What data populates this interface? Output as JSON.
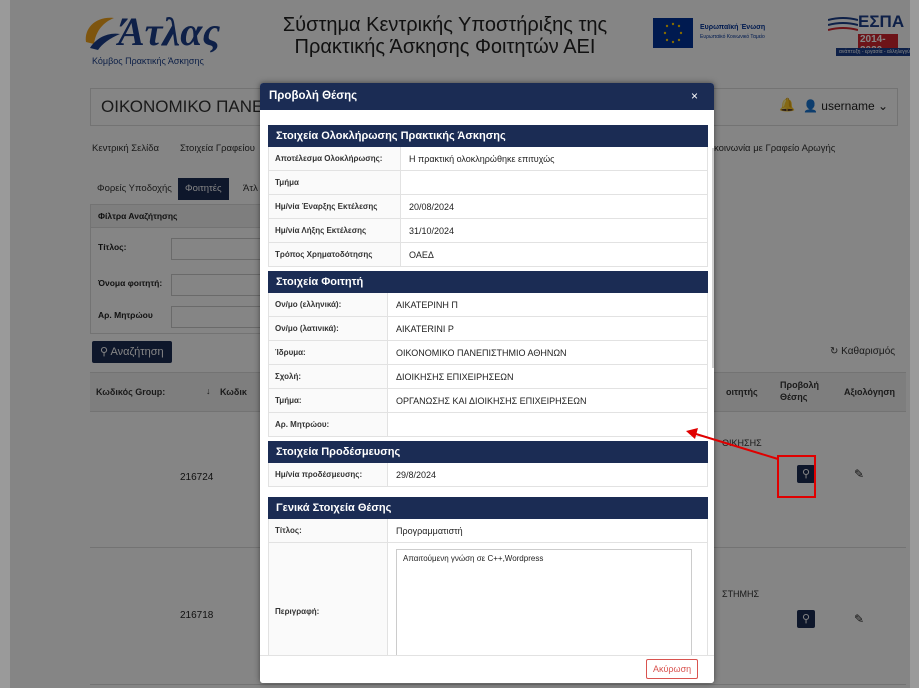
{
  "header": {
    "logo_title": "Άτλας",
    "logo_subtitle": "Κόμβος Πρακτικής Άσκησης",
    "system_title_line1": "Σύστημα Κεντρικής Υποστήριξης της",
    "system_title_line2": "Πρακτικής Άσκησης Φοιτητών ΑΕΙ",
    "eu_label": "Ευρωπαϊκή Ένωση",
    "eu_sub": "Ευρωπαϊκό Κοινωνικό Ταμείο",
    "espa_title": "ΕΣΠΑ",
    "espa_years": "2014-2020",
    "espa_slogan": "ανάπτυξη - εργασία - αλληλεγγύη"
  },
  "university_bar": {
    "name": "ΟΙΚΟΝΟΜΙΚΟ ΠΑΝΕΠΙΣΤΗΜ",
    "username": "username"
  },
  "nav": {
    "items": [
      "Κεντρική Σελίδα",
      "Στοιχεία Γραφείου",
      "κοινωνία με Γραφείο Αρωγής"
    ]
  },
  "subtabs": {
    "items": [
      "Φορείς Υποδοχής",
      "Φοιτητές",
      "Άτλ"
    ]
  },
  "filters": {
    "title": "Φίλτρα Αναζήτησης",
    "labels": [
      "Τίτλος:",
      "Όνομα φοιτητή:",
      "Αρ. Μητρώου"
    ]
  },
  "actions": {
    "search": "Αναζήτηση",
    "clear": "Καθαρισμός"
  },
  "table": {
    "headers": {
      "group_code": "Κωδικός Group:",
      "code": "Κωδικ",
      "student": "οιτητής",
      "view_line1": "Προβολή",
      "view_line2": "Θέσης",
      "evaluation": "Αξιολόγηση"
    },
    "rows": [
      {
        "code": "216724",
        "frag": "ΟΙΚΗΣΗΣ"
      },
      {
        "code": "216718",
        "frag": "ΣΤΗΜΗΣ"
      }
    ]
  },
  "modal": {
    "title": "Προβολή Θέσης",
    "close": "×",
    "cancel": "Ακύρωση",
    "completion": {
      "title": "Στοιχεία Ολοκλήρωσης Πρακτικής Άσκησης",
      "rows": [
        {
          "label": "Αποτέλεσμα Ολοκλήρωσης:",
          "value": "Η πρακτική ολοκληρώθηκε επιτυχώς"
        },
        {
          "label": "Τμήμα",
          "value": ""
        },
        {
          "label": "Ημ/νία Έναρξης Εκτέλεσης",
          "value": "20/08/2024"
        },
        {
          "label": "Ημ/νία Λήξης Εκτέλεσης",
          "value": "31/10/2024"
        },
        {
          "label": "Τρόπος Χρηματοδότησης",
          "value": "ΟΑΕΔ"
        }
      ]
    },
    "student": {
      "title": "Στοιχεία Φοιτητή",
      "rows": [
        {
          "label": "Ον/μο (ελληνικά):",
          "value": "ΑΙΚΑΤΕΡΙΝΗ Π"
        },
        {
          "label": "Ον/μο (λατινικά):",
          "value": "AIKATERINI P"
        },
        {
          "label": "Ίδρυμα:",
          "value": "ΟΙΚΟΝΟΜΙΚΟ ΠΑΝΕΠΙΣΤΗΜΙΟ ΑΘΗΝΩΝ"
        },
        {
          "label": "Σχολή:",
          "value": "ΔΙΟΙΚΗΣΗΣ ΕΠΙΧΕΙΡΗΣΕΩΝ"
        },
        {
          "label": "Τμήμα:",
          "value": "ΟΡΓΑΝΩΣΗΣ ΚΑΙ ΔΙΟΙΚΗΣΗΣ ΕΠΙΧΕΙΡΗΣΕΩΝ"
        },
        {
          "label": "Αρ. Μητρώου:",
          "value": ""
        }
      ]
    },
    "preassignment": {
      "title": "Στοιχεία Προδέσμευσης",
      "rows": [
        {
          "label": "Ημ/νία προδέσμευσης:",
          "value": "29/8/2024"
        }
      ]
    },
    "general": {
      "title": "Γενικά Στοιχεία Θέσης",
      "rows": [
        {
          "label": "Τίτλος:",
          "value": "Προγραμματιστή"
        },
        {
          "label": "Περιγραφή:",
          "value": "Απαιτούμενη γνώση σε C++,Wordpress"
        }
      ]
    }
  },
  "colors": {
    "navy": "#1b2c54",
    "annotation_red": "#e00000"
  }
}
